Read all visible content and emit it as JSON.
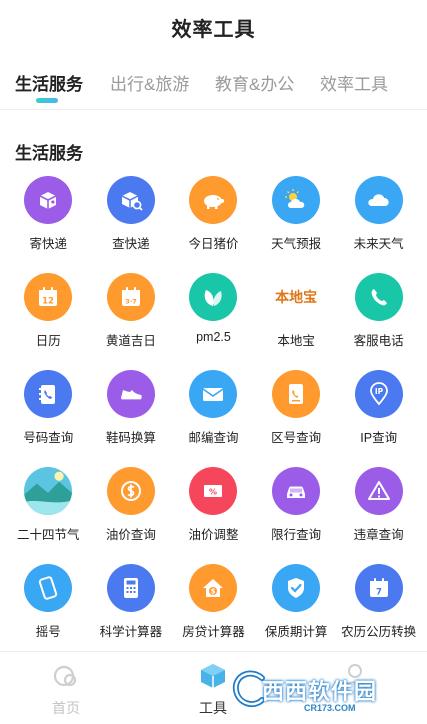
{
  "header": {
    "title": "效率工具"
  },
  "tabs": [
    {
      "label": "生活服务",
      "active": true
    },
    {
      "label": "出行&旅游",
      "active": false
    },
    {
      "label": "教育&办公",
      "active": false
    },
    {
      "label": "效率工具",
      "active": false
    }
  ],
  "section": {
    "title": "生活服务"
  },
  "tools": [
    {
      "label": "寄快递",
      "icon": "package-send-icon",
      "color": "#9b5ce8"
    },
    {
      "label": "查快递",
      "icon": "package-search-icon",
      "color": "#4b79f0"
    },
    {
      "label": "今日猪价",
      "icon": "pig-icon",
      "color": "#ff9a2e"
    },
    {
      "label": "天气预报",
      "icon": "weather-sun-cloud-icon",
      "color": "#3aa7f5"
    },
    {
      "label": "未来天气",
      "icon": "cloud-icon",
      "color": "#3aa7f5"
    },
    {
      "label": "日历",
      "icon": "calendar-icon",
      "color": "#ff9a2e",
      "badge": "12"
    },
    {
      "label": "黄道吉日",
      "icon": "calendar-icon",
      "color": "#ff9a2e",
      "badge": "3·7"
    },
    {
      "label": "pm2.5",
      "icon": "leaf-icon",
      "color": "#19c6a8"
    },
    {
      "label": "本地宝",
      "icon": "bendibao-logo-icon",
      "color": "#ffffff"
    },
    {
      "label": "客服电话",
      "icon": "phone-icon",
      "color": "#19c6a8"
    },
    {
      "label": "号码查询",
      "icon": "phone-book-icon",
      "color": "#4b79f0"
    },
    {
      "label": "鞋码换算",
      "icon": "shoe-icon",
      "color": "#9b5ce8"
    },
    {
      "label": "邮编查询",
      "icon": "envelope-icon",
      "color": "#3aa7f5"
    },
    {
      "label": "区号查询",
      "icon": "phone-card-icon",
      "color": "#ff9a2e"
    },
    {
      "label": "IP查询",
      "icon": "ip-location-icon",
      "color": "#4b79f0",
      "badge": "IP"
    },
    {
      "label": "二十四节气",
      "icon": "landscape-icon",
      "color": "#5bc4e0"
    },
    {
      "label": "油价查询",
      "icon": "dollar-icon",
      "color": "#ff9a2e"
    },
    {
      "label": "油价调整",
      "icon": "percent-ticket-icon",
      "color": "#f5465b",
      "badge": "%"
    },
    {
      "label": "限行查询",
      "icon": "car-icon",
      "color": "#9b5ce8"
    },
    {
      "label": "违章查询",
      "icon": "warning-icon",
      "color": "#9b5ce8"
    },
    {
      "label": "摇号",
      "icon": "phone-shake-icon",
      "color": "#3aa7f5"
    },
    {
      "label": "科学计算器",
      "icon": "calculator-icon",
      "color": "#4b79f0"
    },
    {
      "label": "房贷计算器",
      "icon": "house-dollar-icon",
      "color": "#ff9a2e"
    },
    {
      "label": "保质期计算",
      "icon": "shield-check-icon",
      "color": "#3aa7f5"
    },
    {
      "label": "农历公历转换",
      "icon": "calendar-icon",
      "color": "#4b79f0",
      "badge": "7"
    }
  ],
  "bendibao_logo_text": "本地宝",
  "tabbar": [
    {
      "label": "首页",
      "icon": "home-icon",
      "active": false
    },
    {
      "label": "工具",
      "icon": "tools-box-icon",
      "active": true
    },
    {
      "label": "",
      "icon": "user-icon",
      "active": false
    }
  ],
  "watermark": {
    "main": "西西软件园",
    "sub": "CR173.COM"
  }
}
